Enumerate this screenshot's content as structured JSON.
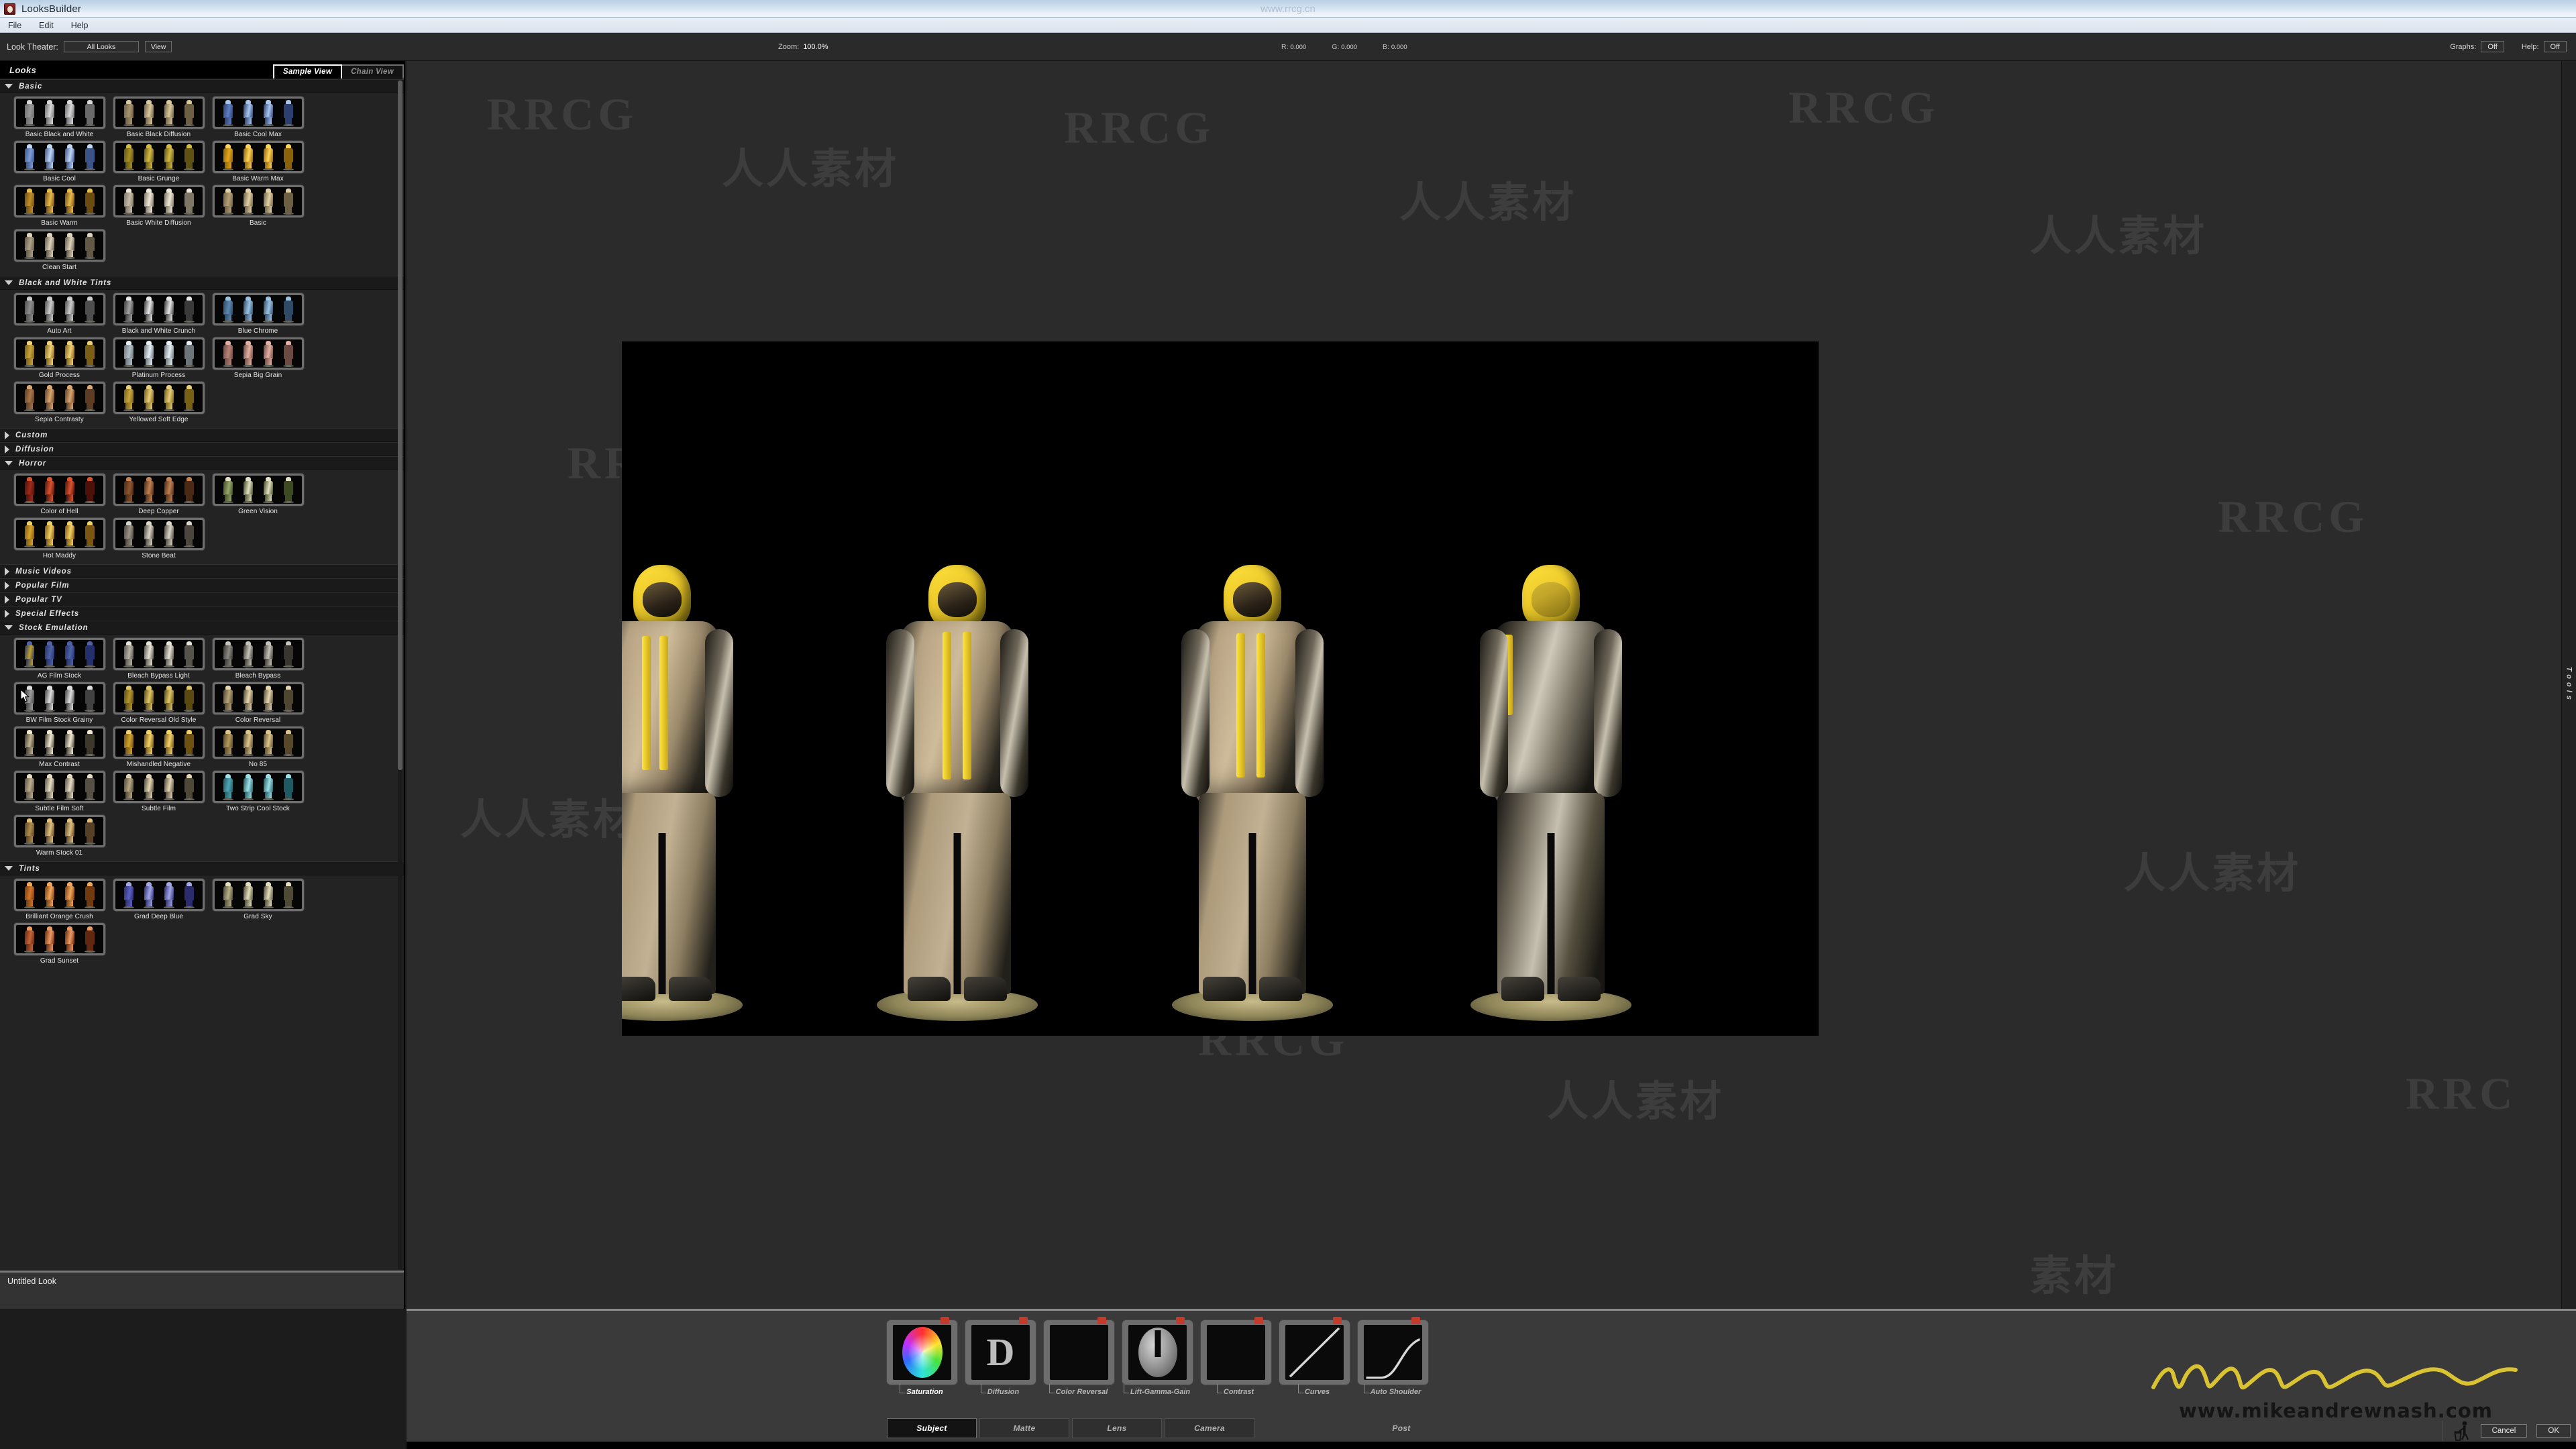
{
  "window": {
    "title": "LooksBuilder",
    "watermark_top": "www.rrcg.cn",
    "app_icon": "bug-icon"
  },
  "menu": {
    "items": [
      {
        "label": "File"
      },
      {
        "label": "Edit"
      },
      {
        "label": "Help"
      }
    ]
  },
  "toolbar": {
    "look_theater_label": "Look Theater:",
    "look_theater_value": "All Looks",
    "view_button": "View",
    "zoom_label": "Zoom:",
    "zoom_value": "100.0%",
    "rgb": [
      {
        "label": "R:",
        "value": "0.000"
      },
      {
        "label": "G:",
        "value": "0.000"
      },
      {
        "label": "B:",
        "value": "0.000"
      }
    ],
    "graphs_label": "Graphs:",
    "graphs_value": "Off",
    "help_label": "Help:",
    "help_value": "Off"
  },
  "left_panel": {
    "header_title": "Looks",
    "tabs": [
      {
        "label": "Sample View",
        "active": true
      },
      {
        "label": "Chain View",
        "active": false
      }
    ],
    "status": "Untitled Look",
    "categories": [
      {
        "name": "Basic",
        "expanded": true,
        "looks": [
          {
            "label": "Basic Black and White",
            "c1": "#9a9a9a",
            "c2": "#d8d8d8",
            "c3": "#6a6a6a"
          },
          {
            "label": "Basic Black Diffusion",
            "c1": "#a89471",
            "c2": "#d9c79c",
            "c3": "#6d5f44"
          },
          {
            "label": "Basic Cool Max",
            "c1": "#5f7fc4",
            "c2": "#a9c6ef",
            "c3": "#2c3f6e"
          },
          {
            "label": "Basic Cool",
            "c1": "#7e9ed8",
            "c2": "#c0d6f5",
            "c3": "#3a5286"
          },
          {
            "label": "Basic Grunge",
            "c1": "#a79026",
            "c2": "#d4bb44",
            "c3": "#5e5213"
          },
          {
            "label": "Basic Warm Max",
            "c1": "#e2a71c",
            "c2": "#ffd457",
            "c3": "#8a6209"
          },
          {
            "label": "Basic Warm",
            "c1": "#c08f28",
            "c2": "#e8b94c",
            "c3": "#6b4c10"
          },
          {
            "label": "Basic White Diffusion",
            "c1": "#c4bca6",
            "c2": "#eee7d6",
            "c3": "#7d7664"
          },
          {
            "label": "Basic",
            "c1": "#b5a177",
            "c2": "#e1d0a6",
            "c3": "#6d5f42"
          },
          {
            "label": "Clean Start",
            "c1": "#aea28a",
            "c2": "#ddd2bb",
            "c3": "#615846"
          }
        ]
      },
      {
        "name": "Black and White Tints",
        "expanded": true,
        "looks": [
          {
            "label": "Auto Art",
            "c1": "#8e8e8e",
            "c2": "#cdcdcd",
            "c3": "#4e4e4e"
          },
          {
            "label": "Black and White Crunch",
            "c1": "#a2a2a2",
            "c2": "#e7e7e7",
            "c3": "#3a3a3a"
          },
          {
            "label": "Blue Chrome",
            "c1": "#5d87ae",
            "c2": "#9cc2e2",
            "c3": "#2d4a66"
          },
          {
            "label": "Gold Process",
            "c1": "#c9a43c",
            "c2": "#f0d177",
            "c3": "#7a5e14"
          },
          {
            "label": "Platinum Process",
            "c1": "#b3c0c6",
            "c2": "#e5eef2",
            "c3": "#6b757a"
          },
          {
            "label": "Sepia Big Grain",
            "c1": "#b98478",
            "c2": "#e3b0a3",
            "c3": "#6d4a41"
          },
          {
            "label": "Sepia Contrasty",
            "c1": "#a8764a",
            "c2": "#d9a771",
            "c3": "#5c3d23"
          },
          {
            "label": "Yellowed Soft Edge",
            "c1": "#c9a63e",
            "c2": "#e8cd79",
            "c3": "#756013"
          }
        ]
      },
      {
        "name": "Custom",
        "expanded": false,
        "looks": []
      },
      {
        "name": "Diffusion",
        "expanded": false,
        "looks": []
      },
      {
        "name": "Horror",
        "expanded": true,
        "looks": [
          {
            "label": "Color of Hell",
            "c1": "#9e2b1c",
            "c2": "#d9532f",
            "c3": "#4d1109"
          },
          {
            "label": "Deep Copper",
            "c1": "#8d5531",
            "c2": "#c08052",
            "c3": "#4a2a14"
          },
          {
            "label": "Green Vision",
            "c1": "#9aa86b",
            "c2": "#e2dfc2",
            "c3": "#3e4a22"
          },
          {
            "label": "Hot Maddy",
            "c1": "#d8a52c",
            "c2": "#f2cf63",
            "c3": "#7a5610"
          },
          {
            "label": "Stone Beat",
            "c1": "#9c9488",
            "c2": "#d8d4c6",
            "c3": "#4b463d"
          }
        ]
      },
      {
        "name": "Music Videos",
        "expanded": false,
        "looks": []
      },
      {
        "name": "Popular Film",
        "expanded": false,
        "looks": []
      },
      {
        "name": "Popular TV",
        "expanded": false,
        "looks": []
      },
      {
        "name": "Special Effects",
        "expanded": false,
        "looks": []
      },
      {
        "name": "Stock Emulation",
        "expanded": true,
        "looks": [
          {
            "label": "AG Film Stock",
            "c1": "#c0a12c",
            "c2": "#4f63a6",
            "c3": "#23306b"
          },
          {
            "label": "Bleach Bypass Light",
            "c1": "#b6b2a5",
            "c2": "#e6e2d6",
            "c3": "#56534a"
          },
          {
            "label": "Bleach Bypass",
            "c1": "#8c8a84",
            "c2": "#c6c3ba",
            "c3": "#37352f"
          },
          {
            "label": "BW Film Stock Grainy",
            "c1": "#9d9d9d",
            "c2": "#dedede",
            "c3": "#414141"
          },
          {
            "label": "Color Reversal Old Style",
            "c1": "#b4962f",
            "c2": "#e0c669",
            "c3": "#5a4a10"
          },
          {
            "label": "Color Reversal",
            "c1": "#b9a479",
            "c2": "#e6d6ae",
            "c3": "#4f4631"
          },
          {
            "label": "Max Contrast",
            "c1": "#c2b494",
            "c2": "#f0e8d2",
            "c3": "#3d382c"
          },
          {
            "label": "Mishandled Negative",
            "c1": "#d2a32c",
            "c2": "#f3d269",
            "c3": "#6d5110"
          },
          {
            "label": "No 85",
            "c1": "#b59a5c",
            "c2": "#ddc68c",
            "c3": "#58482a"
          },
          {
            "label": "Subtle Film Soft",
            "c1": "#bdad8e",
            "c2": "#e9ddc4",
            "c3": "#545044"
          },
          {
            "label": "Subtle Film",
            "c1": "#b7a682",
            "c2": "#e4d6b5",
            "c3": "#4e4837"
          },
          {
            "label": "Two Strip Cool Stock",
            "c1": "#4fa7b3",
            "c2": "#9fe0e7",
            "c3": "#1f5a63"
          },
          {
            "label": "Warm Stock 01",
            "c1": "#b08e4c",
            "c2": "#dfc07d",
            "c3": "#554025"
          }
        ]
      },
      {
        "name": "Tints",
        "expanded": true,
        "looks": [
          {
            "label": "Brilliant Orange Crush",
            "c1": "#d5762a",
            "c2": "#f3a75b",
            "c3": "#6f3a0e"
          },
          {
            "label": "Grad Deep Blue",
            "c1": "#5d61c0",
            "c2": "#a3a7e6",
            "c3": "#2a2c6e"
          },
          {
            "label": "Grad Sky",
            "c1": "#b7b289",
            "c2": "#e3dfbd",
            "c3": "#4d4a35"
          },
          {
            "label": "Grad Sunset",
            "c1": "#c4663a",
            "c2": "#ec9a63",
            "c3": "#62280f"
          }
        ]
      }
    ]
  },
  "viewport": {
    "tools_tab_label": "Tools",
    "watermarks": [
      "RRCG",
      "人人素材"
    ]
  },
  "bottom": {
    "nodes": [
      {
        "label": "Saturation",
        "icon": "color-wheel-icon",
        "active": true
      },
      {
        "label": "Diffusion",
        "icon": "letter-d-icon",
        "active": false
      },
      {
        "label": "Color Reversal",
        "icon": "gradient-icon",
        "active": false
      },
      {
        "label": "Lift-Gamma-Gain",
        "icon": "sphere-icon",
        "active": false
      },
      {
        "label": "Contrast",
        "icon": "ramp-icon",
        "active": false
      },
      {
        "label": "Curves",
        "icon": "curve-line-icon",
        "active": false
      },
      {
        "label": "Auto Shoulder",
        "icon": "shoulder-curve-icon",
        "active": false
      }
    ],
    "tabs": [
      {
        "label": "Subject",
        "active": true
      },
      {
        "label": "Matte",
        "active": false
      },
      {
        "label": "Lens",
        "active": false
      },
      {
        "label": "Camera",
        "active": false
      },
      {
        "label": "Post",
        "active": false
      }
    ],
    "signature_url": "www.mikeandrewnash.com",
    "trash_icon": "trash-icon",
    "cancel_button": "Cancel",
    "ok_button": "OK"
  }
}
